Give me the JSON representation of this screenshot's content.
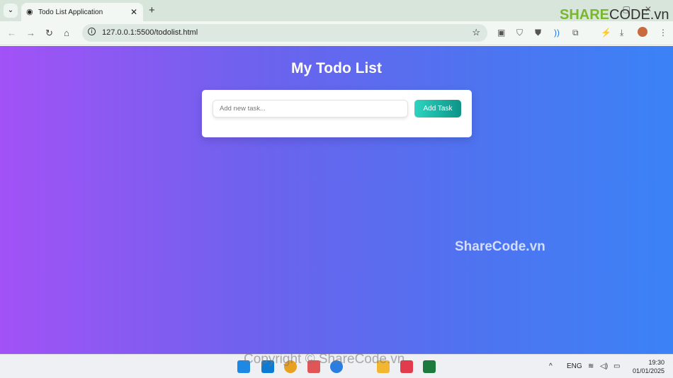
{
  "browser": {
    "tab_title": "Todo List Application",
    "url": "127.0.0.1:5500/todolist.html",
    "new_tab": "+",
    "close_tab": "✕"
  },
  "logo": {
    "brand": "SHARE",
    "brand2": "CODE.vn"
  },
  "app": {
    "title": "My Todo List",
    "input_placeholder": "Add new task...",
    "input_value": "",
    "add_button": "Add Task"
  },
  "watermark": "ShareCode.vn",
  "copyright": "Copyright © ShareCode.vn",
  "taskbar": {
    "language": "ENG",
    "time": "19:30",
    "date": "01/01/2025"
  },
  "colors": {
    "gradient_start": "#a252f6",
    "gradient_end": "#3b82f6",
    "button_start": "#2dd4bf",
    "button_end": "#0d9488"
  }
}
